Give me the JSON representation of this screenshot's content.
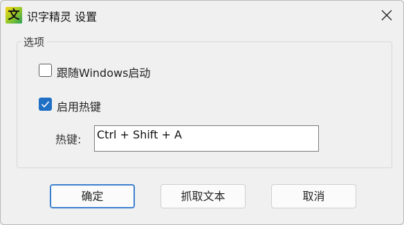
{
  "window": {
    "title": "识字精灵 设置",
    "app_icon_glyph": "文",
    "close_icon": "close-icon"
  },
  "options": {
    "group_label": "选项",
    "startup_label": "跟随Windows启动",
    "startup_checked": false,
    "hotkey_enable_label": "启用热键",
    "hotkey_enable_checked": true,
    "hotkey_label": "热键:",
    "hotkey_value": "Ctrl + Shift + A"
  },
  "buttons": {
    "ok": "确定",
    "capture": "抓取文本",
    "cancel": "取消"
  },
  "colors": {
    "accent": "#1f6fc5",
    "window_bg": "#f0f0f0"
  }
}
